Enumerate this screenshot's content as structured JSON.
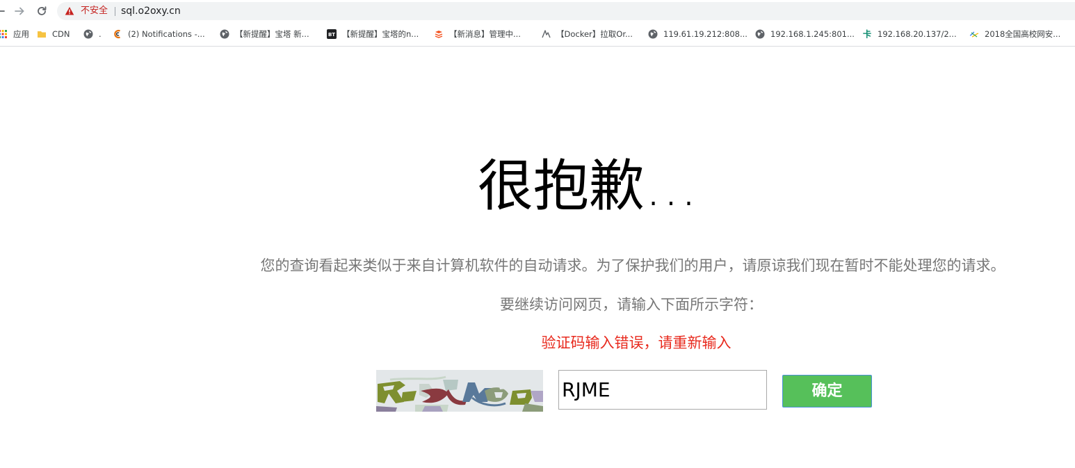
{
  "browser": {
    "security_label": "不安全",
    "url": "sql.o2oxy.cn"
  },
  "bookmarks": [
    {
      "label": "应用",
      "icon": "apps-grid-icon"
    },
    {
      "label": "CDN",
      "icon": "folder-icon"
    },
    {
      "label": ".",
      "icon": "globe-icon"
    },
    {
      "label": "(2) Notifications -...",
      "icon": "notifications-site-icon"
    },
    {
      "label": "【新提醒】宝塔 新...",
      "icon": "globe-icon"
    },
    {
      "label": "【新提醒】宝塔的n...",
      "icon": "bt-logo-icon"
    },
    {
      "label": "【新消息】管理中...",
      "icon": "admin-site-icon"
    },
    {
      "label": "【Docker】拉取Or...",
      "icon": "docker-site-icon"
    },
    {
      "label": "119.61.19.212:808...",
      "icon": "globe-icon"
    },
    {
      "label": "192.168.1.245:801...",
      "icon": "globe-icon"
    },
    {
      "label": "192.168.20.137/2...",
      "icon": "ka-site-icon"
    },
    {
      "label": "2018全国高校网安...",
      "icon": "ctf-site-icon"
    }
  ],
  "page": {
    "title": "很抱歉...",
    "message": "您的查询看起来类似于来自计算机软件的自动请求。为了保护我们的用户，请原谅我们现在暂时不能处理您的请求。",
    "prompt": "要继续访问网页，请输入下面所示字符：",
    "error": "验证码输入错误，请重新输入",
    "captcha_value": "RJME",
    "submit_label": "确定"
  },
  "colors": {
    "error": "#e82a1e",
    "button_bg": "#56c05a",
    "insecure": "#c5221f"
  }
}
